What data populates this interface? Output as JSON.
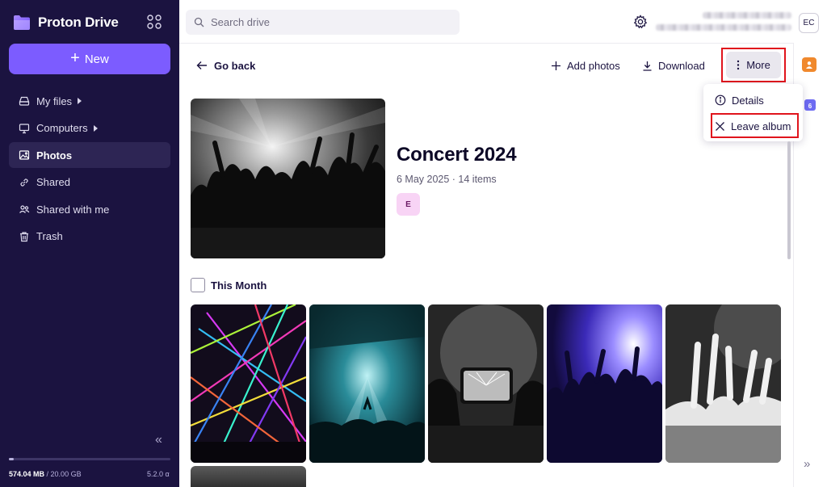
{
  "app": {
    "brand": "Proton Drive"
  },
  "sidebar": {
    "new_label": "New",
    "items": [
      {
        "label": "My files",
        "icon": "hard-drive-icon",
        "expandable": true
      },
      {
        "label": "Computers",
        "icon": "computer-icon",
        "expandable": true
      },
      {
        "label": "Photos",
        "icon": "image-icon",
        "active": true
      },
      {
        "label": "Shared",
        "icon": "link-icon"
      },
      {
        "label": "Shared with me",
        "icon": "users-icon"
      },
      {
        "label": "Trash",
        "icon": "trash-icon"
      }
    ],
    "storage": {
      "used": "574.04 MB",
      "separator": " / ",
      "total": "20.00 GB",
      "used_fraction": 0.029
    },
    "version": "5.2.0 α"
  },
  "header": {
    "search_placeholder": "Search drive",
    "avatar_initials": "EC"
  },
  "toolbar": {
    "go_back": "Go back",
    "add_photos": "Add photos",
    "download": "Download",
    "more": "More"
  },
  "menu": {
    "items": [
      {
        "label": "Details",
        "icon": "info-icon"
      },
      {
        "label": "Leave album",
        "icon": "close-icon"
      }
    ]
  },
  "album": {
    "title": "Concert 2024",
    "meta": "6 May 2025 · 14 items",
    "member_initial": "E"
  },
  "section": {
    "label": "This Month"
  },
  "rail": {
    "badge": "6"
  },
  "colors": {
    "sidebar_bg": "#1b1340",
    "accent": "#7c5cff",
    "highlight": "#e0141c"
  }
}
